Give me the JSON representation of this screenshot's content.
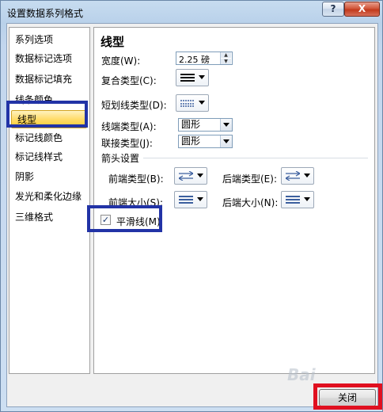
{
  "window": {
    "title": "设置数据系列格式",
    "help_label": "?",
    "close_label": "X"
  },
  "nav": {
    "items": [
      {
        "label": "系列选项",
        "selected": false
      },
      {
        "label": "数据标记选项",
        "selected": false
      },
      {
        "label": "数据标记填充",
        "selected": false
      },
      {
        "label": "线条颜色",
        "selected": false
      },
      {
        "label": "线型",
        "selected": true
      },
      {
        "label": "标记线颜色",
        "selected": false
      },
      {
        "label": "标记线样式",
        "selected": false
      },
      {
        "label": "阴影",
        "selected": false
      },
      {
        "label": "发光和柔化边缘",
        "selected": false
      },
      {
        "label": "三维格式",
        "selected": false
      }
    ]
  },
  "panel": {
    "heading": "线型",
    "width_label": "宽度(W):",
    "width_value": "2.25 磅",
    "compound_label": "复合类型(C):",
    "dash_label": "短划线类型(D):",
    "cap_label": "线端类型(A):",
    "cap_value": "圆形",
    "join_label": "联接类型(J):",
    "join_value": "圆形",
    "arrow_section": "箭头设置",
    "begin_type_label": "前端类型(B):",
    "end_type_label": "后端类型(E):",
    "begin_size_label": "前端大小(S):",
    "end_size_label": "后端大小(N):",
    "smooth_label": "平滑线(M)",
    "smooth_checked": true
  },
  "footer": {
    "close_button": "关闭"
  },
  "watermark": "Bai"
}
